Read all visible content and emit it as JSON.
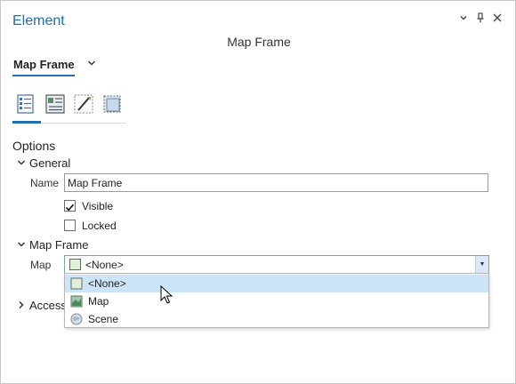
{
  "pane": {
    "title": "Element",
    "dropdown_icon": "chevron-down-icon",
    "pin_icon": "pin-icon",
    "close_icon": "close-icon"
  },
  "subtitle": "Map Frame",
  "element_selector": {
    "value": "Map Frame",
    "chevron": "⌄"
  },
  "tabs": [
    {
      "name": "options-tab",
      "icon": "options-icon",
      "active": true
    },
    {
      "name": "placement-tab",
      "icon": "placement-icon"
    },
    {
      "name": "display-tab",
      "icon": "display-icon"
    },
    {
      "name": "frame-tab",
      "icon": "frame-icon"
    }
  ],
  "section_title": "Options",
  "general": {
    "header": "General",
    "name_label": "Name",
    "name_value": "Map Frame",
    "visible_label": "Visible",
    "visible_checked": true,
    "locked_label": "Locked",
    "locked_checked": false
  },
  "map_frame": {
    "header": "Map Frame",
    "map_label": "Map",
    "map_value": "<None>",
    "options": [
      {
        "label": "<None>",
        "icon": "none-map-icon",
        "selected": true
      },
      {
        "label": "Map",
        "icon": "map-icon",
        "selected": false
      },
      {
        "label": "Scene",
        "icon": "scene-globe-icon",
        "selected": false
      }
    ]
  },
  "access_group": {
    "header": "Access"
  },
  "colors": {
    "accent": "#1f6fb2",
    "selection": "#cce4f7"
  }
}
